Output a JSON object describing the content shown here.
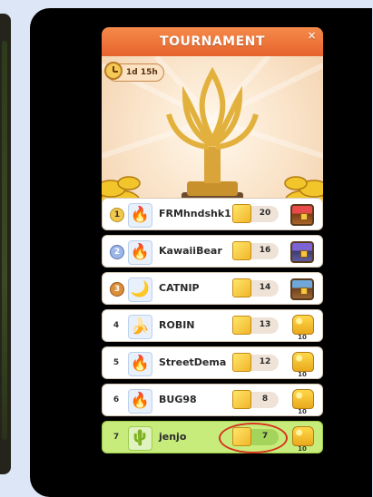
{
  "dialog": {
    "title": "TOURNAMENT",
    "close_label": "×",
    "timer": "1d 15h"
  },
  "leaderboard": [
    {
      "rank": "1",
      "rank_style": "gold",
      "avatar": "🔥",
      "avatar_icon": "flame-icon",
      "name": "FRMhndshk1",
      "score": "20",
      "reward": "chest-red",
      "reward_count": ""
    },
    {
      "rank": "2",
      "rank_style": "silver",
      "avatar": "🔥",
      "avatar_icon": "flame-icon",
      "name": "KawaiiBear",
      "score": "16",
      "reward": "chest-purple",
      "reward_count": ""
    },
    {
      "rank": "3",
      "rank_style": "bronze",
      "avatar": "🌙",
      "avatar_icon": "moon-icon",
      "name": "CATNIP",
      "score": "14",
      "reward": "chest-wood",
      "reward_count": ""
    },
    {
      "rank": "4",
      "rank_style": "plain",
      "avatar": "🍌",
      "avatar_icon": "banana-icon",
      "name": "ROBIN",
      "score": "13",
      "reward": "coins",
      "reward_count": "10"
    },
    {
      "rank": "5",
      "rank_style": "plain",
      "avatar": "🔥",
      "avatar_icon": "flame-icon",
      "name": "StreetDema",
      "score": "12",
      "reward": "coins",
      "reward_count": "10"
    },
    {
      "rank": "6",
      "rank_style": "plain",
      "avatar": "🔥",
      "avatar_icon": "flame-icon",
      "name": "BUG98",
      "score": "8",
      "reward": "coins",
      "reward_count": "10"
    },
    {
      "rank": "7",
      "rank_style": "plain",
      "avatar": "🌵",
      "avatar_icon": "cactus-icon",
      "name": "jenjo",
      "score": "7",
      "reward": "coins",
      "reward_count": "10",
      "is_current_user": true
    }
  ],
  "colors": {
    "header": "#e6632d",
    "current_user_row": "#c8ec7c",
    "highlight_ring": "#d6341f"
  }
}
